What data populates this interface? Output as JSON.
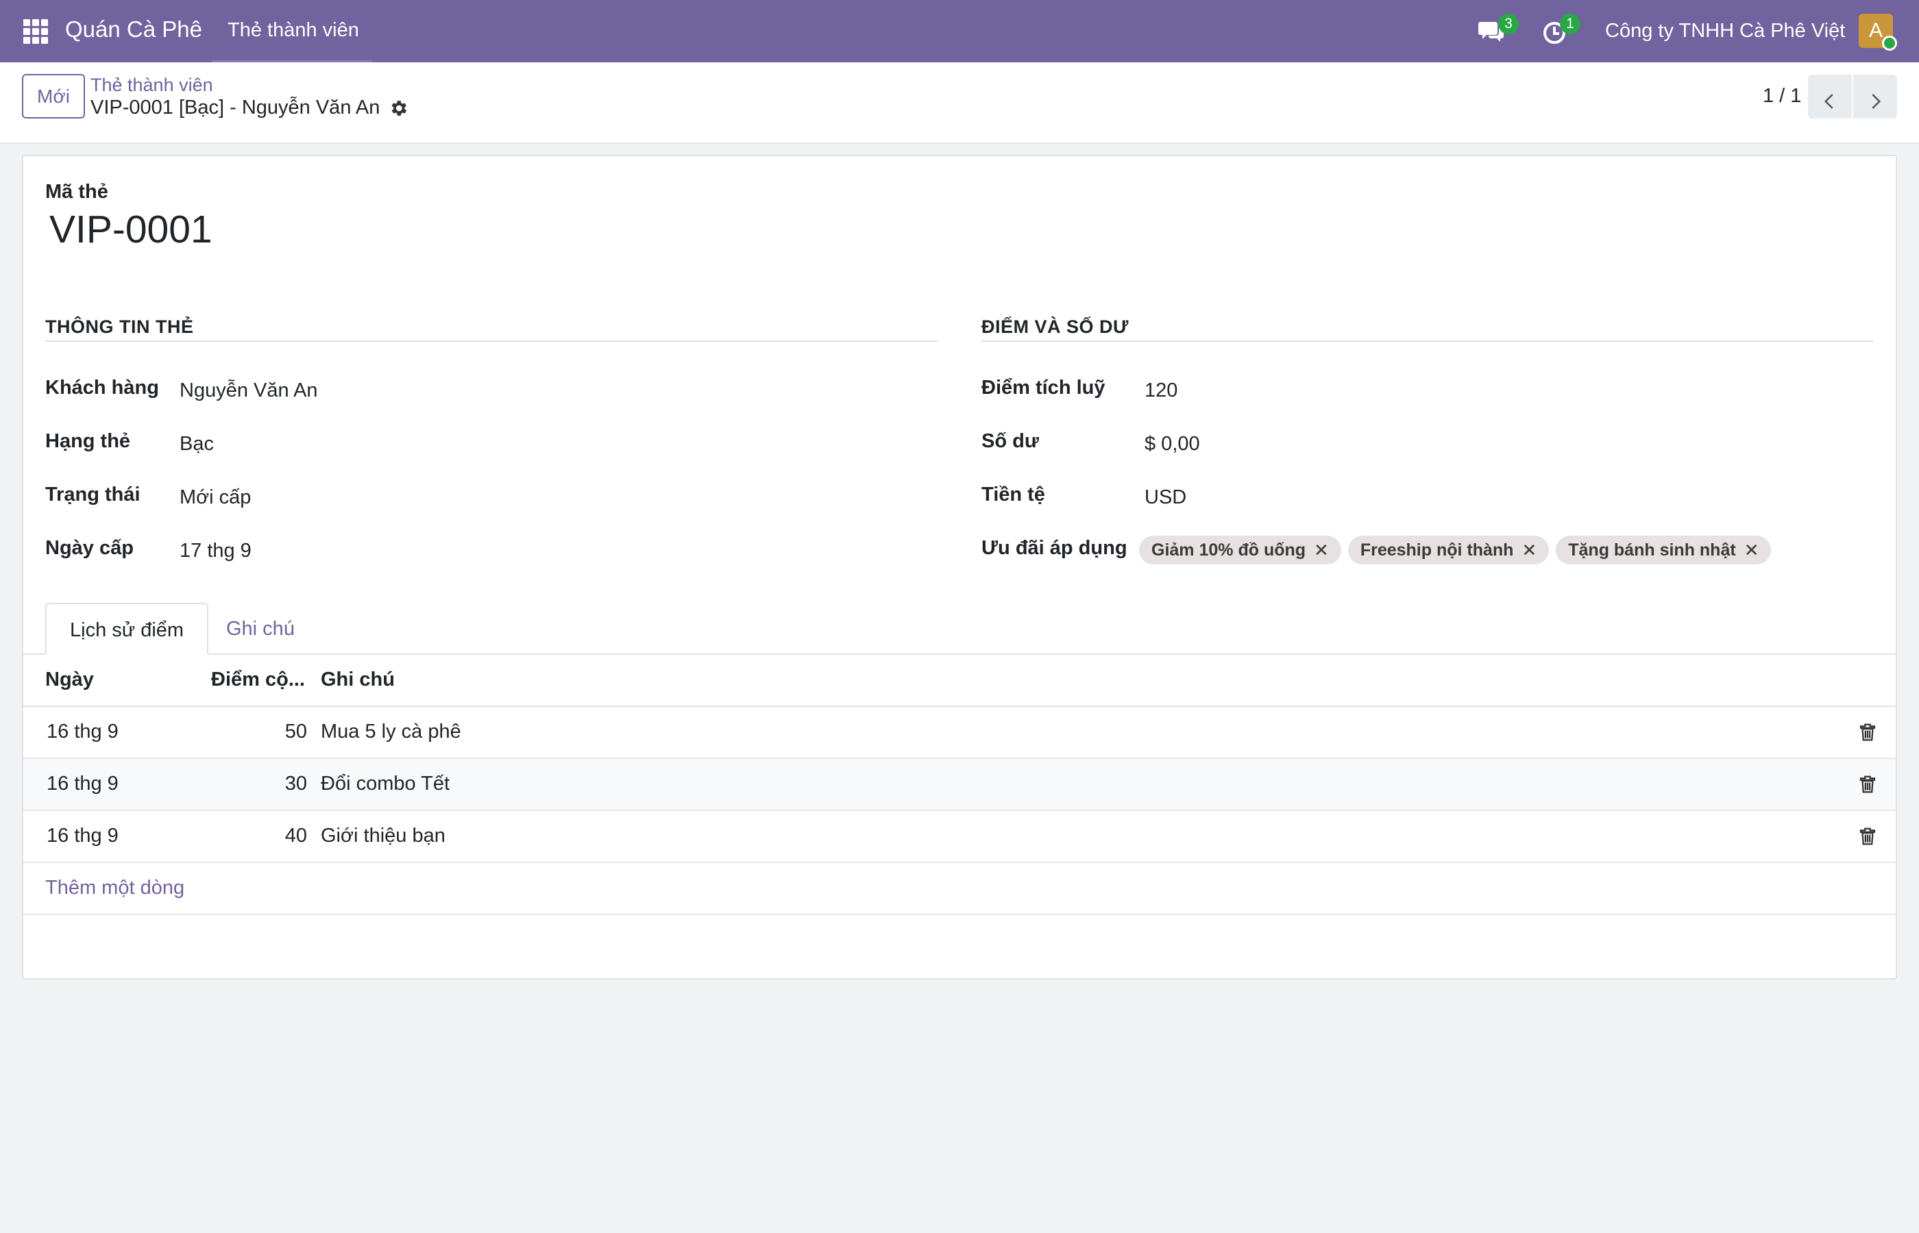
{
  "navbar": {
    "brand": "Quán Cà Phê",
    "menu": "Thẻ thành viên",
    "chat_count": "3",
    "activity_count": "1",
    "company": "Công ty TNHH Cà Phê Việt",
    "avatar_letter": "A"
  },
  "control": {
    "new_label": "Mới",
    "breadcrumb_parent": "Thẻ thành viên",
    "breadcrumb_current": "VIP-0001 [Bạc] - Nguyễn Văn An",
    "pager": "1 / 1"
  },
  "form": {
    "code_label": "Mã thẻ",
    "code_value": "VIP-0001",
    "left_group": {
      "title": "THÔNG TIN THẺ",
      "fields": [
        {
          "label": "Khách hàng",
          "value": "Nguyễn Văn An"
        },
        {
          "label": "Hạng thẻ",
          "value": "Bạc"
        },
        {
          "label": "Trạng thái",
          "value": "Mới cấp"
        },
        {
          "label": "Ngày cấp",
          "value": "17 thg 9"
        }
      ]
    },
    "right_group": {
      "title": "ĐIỂM VÀ SỐ DƯ",
      "fields": [
        {
          "label": "Điểm tích luỹ",
          "value": "120"
        },
        {
          "label": "Số dư",
          "value": "$ 0,00"
        },
        {
          "label": "Tiền tệ",
          "value": "USD"
        },
        {
          "label": "Ưu đãi áp dụng",
          "value": ""
        }
      ],
      "tags": [
        "Giảm 10% đồ uống",
        "Freeship nội thành",
        "Tặng bánh sinh nhật"
      ]
    }
  },
  "tabs": [
    "Lịch sử điểm",
    "Ghi chú"
  ],
  "table": {
    "columns": [
      "Ngày",
      "Điểm cộ...",
      "Ghi chú"
    ],
    "rows": [
      {
        "date": "16 thg 9",
        "points": "50",
        "note": "Mua 5 ly cà phê"
      },
      {
        "date": "16 thg 9",
        "points": "30",
        "note": "Đổi combo Tết"
      },
      {
        "date": "16 thg 9",
        "points": "40",
        "note": "Giới thiệu bạn"
      }
    ],
    "add_line": "Thêm một dòng"
  },
  "colors": {
    "primary": "#71639e",
    "badge": "#28a745",
    "avatar": "#c9963a"
  }
}
